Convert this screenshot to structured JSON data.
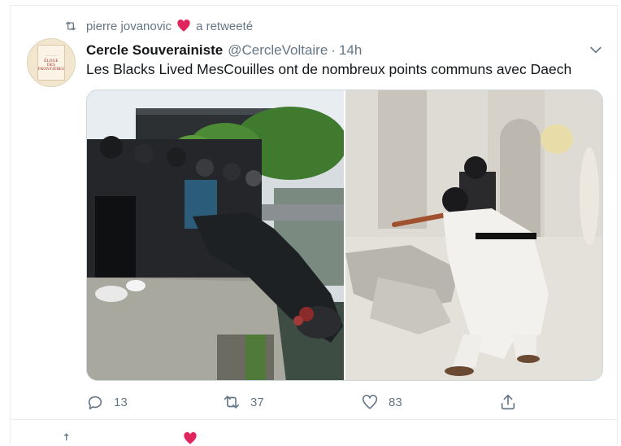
{
  "retweet_context": {
    "user": "pierre jovanovic",
    "suffix": "a retweeté",
    "icon": "retweet-icon",
    "emoji": "red-heart-emoji",
    "heart_color": "#e0245e"
  },
  "tweet": {
    "avatar": {
      "icon": "book-cover-avatar",
      "book_title_line1": "ÉLOGE",
      "book_title_line2": "DES",
      "book_title_line3": "FRONTIÈRES"
    },
    "display_name": "Cercle Souverainiste",
    "handle": "@CercleVoltaire",
    "separator": "·",
    "time": "14h",
    "text": "Les Blacks Lived MesCouilles ont de nombreux points communs avec Daech",
    "media": [
      {
        "icon": "photo-statue-toppled"
      },
      {
        "icon": "photo-statue-smashed"
      }
    ],
    "actions": {
      "reply_count": "13",
      "retweet_count": "37",
      "like_count": "83"
    }
  },
  "colors": {
    "secondary_text": "#657786",
    "border": "#e6ecf0",
    "primary_text": "#14171a"
  }
}
